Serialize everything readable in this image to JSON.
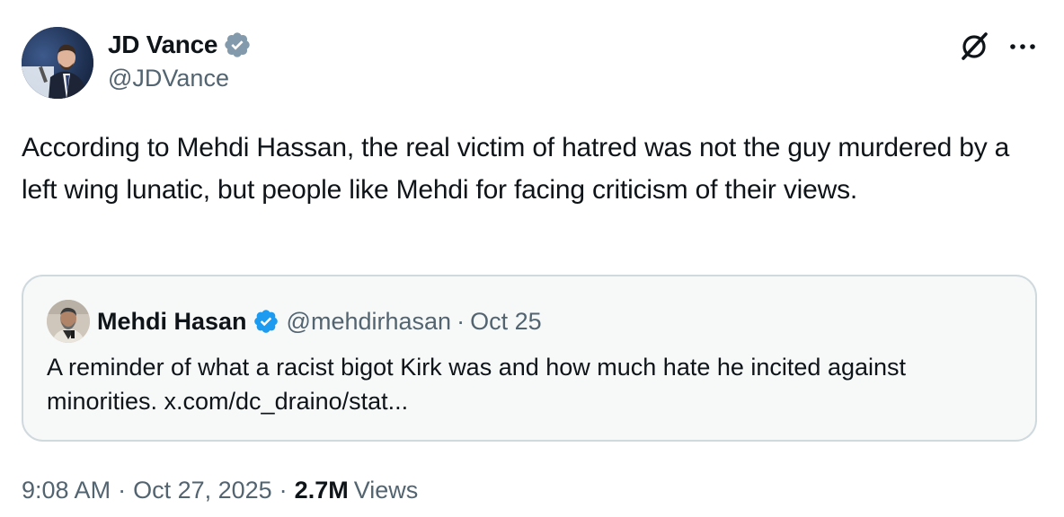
{
  "colors": {
    "text_primary": "#0f1419",
    "text_secondary": "#536471",
    "verified_gray": "#829aab",
    "verified_blue": "#1d9bf0",
    "quote_border": "#cfd9de",
    "quote_background": "#f7f9f9"
  },
  "author": {
    "name": "JD Vance",
    "handle": "@JDVance",
    "verified_badge": "verified-gray-badge-icon",
    "avatar": "avatar"
  },
  "actions": {
    "grok_icon": "grok-icon",
    "more_icon": "more-icon"
  },
  "tweet": {
    "text": "According to Mehdi Hassan, the real victim of hatred was not the guy murdered by a left wing lunatic, but people like Mehdi for facing criticism of their views."
  },
  "quote": {
    "name": "Mehdi Hasan",
    "handle": "@mehdirhasan",
    "separator": "·",
    "date": "Oct 25",
    "verified_badge": "verified-blue-badge-icon",
    "text": "A reminder of what a racist bigot Kirk was and how much hate he incited against minorities. x.com/dc_draino/stat..."
  },
  "meta": {
    "time": "9:08 AM",
    "separator": "·",
    "date": "Oct 27, 2025",
    "views_count": "2.7M",
    "views_label": "Views"
  }
}
